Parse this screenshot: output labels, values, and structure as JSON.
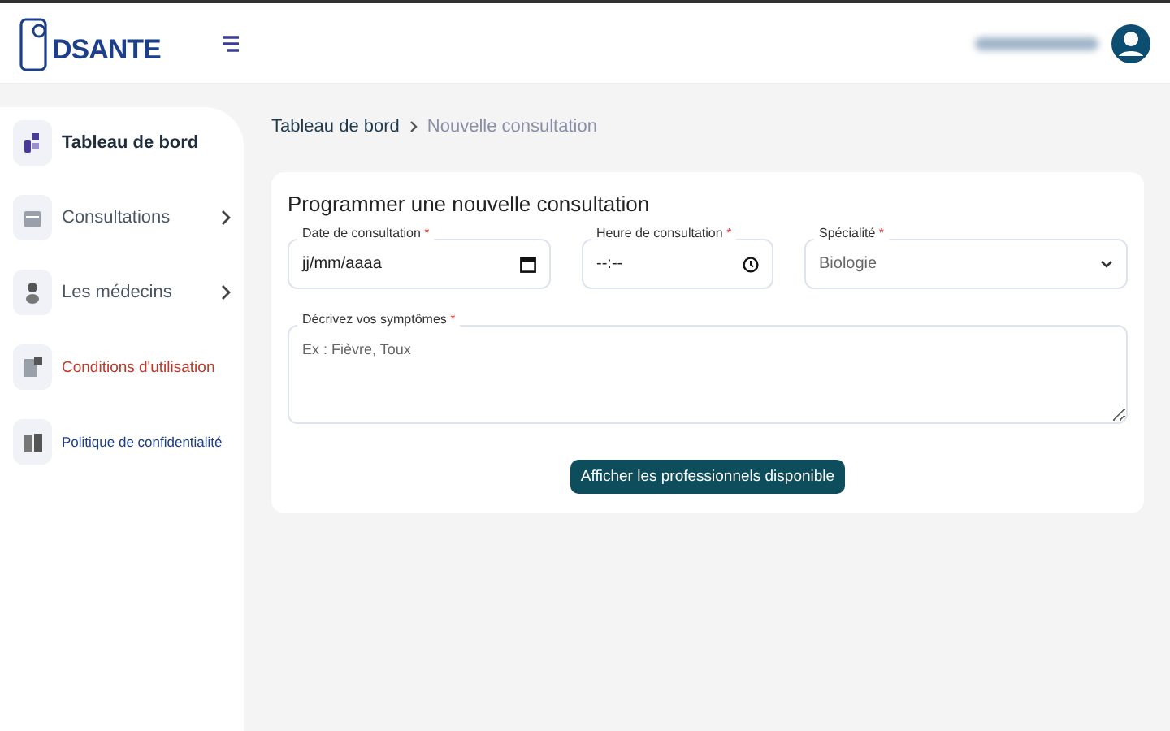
{
  "header": {
    "logo_text": "DSANTE"
  },
  "sidebar": {
    "items": [
      {
        "label": "Tableau de bord",
        "selected": true,
        "has_submenu": false,
        "color": "#1f2d3d"
      },
      {
        "label": "Consultations",
        "selected": false,
        "has_submenu": true,
        "color": "#4b5563"
      },
      {
        "label": "Les médecins",
        "selected": false,
        "has_submenu": true,
        "color": "#4b5563"
      },
      {
        "label": "Conditions d'utilisation",
        "selected": false,
        "has_submenu": false,
        "color": "#c0392b"
      },
      {
        "label": "Politique de confidentialité",
        "selected": false,
        "has_submenu": false,
        "color": "#1d3f8a"
      }
    ]
  },
  "breadcrumb": [
    {
      "label": "Tableau de bord",
      "selected": false
    },
    {
      "label": "Nouvelle consultation",
      "selected": true
    }
  ],
  "form": {
    "title": "Programmer une nouvelle consultation",
    "fields": [
      {
        "kind": "date",
        "label": "Date de consultation",
        "required_mark": "*",
        "placeholder": "jj/mm/aaaa"
      },
      {
        "kind": "time",
        "label": "Heure de consultation",
        "required_mark": "*",
        "placeholder": "--:--"
      },
      {
        "kind": "select",
        "label": "Spécialité",
        "required_mark": "*",
        "value": "Biologie"
      }
    ],
    "symptoms": {
      "label": "Décrivez vos symptômes",
      "required_mark": "*",
      "placeholder": "Ex : Fièvre, Toux"
    },
    "submit": "Afficher les professionnels disponible"
  }
}
